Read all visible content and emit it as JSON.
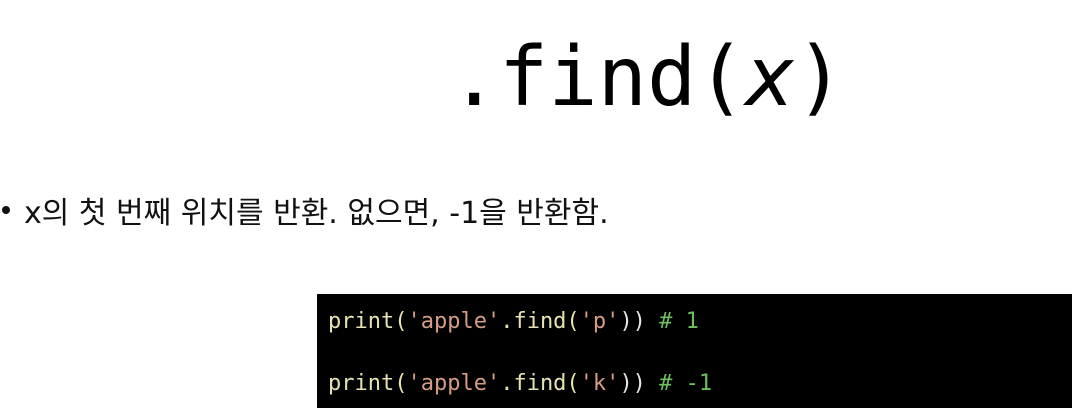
{
  "slide": {
    "title_prefix": ".find(",
    "title_arg": "x",
    "title_suffix": ")",
    "bullet_text": "x의 첫 번째 위치를 반환. 없으면, -1을 반환함."
  },
  "code": {
    "lines": [
      {
        "fn": "print(",
        "str1": "'apple'",
        "method": ".find(",
        "str2": "'p'",
        "close": "))",
        "comment": " # 1"
      },
      {
        "fn": "print(",
        "str1": "'apple'",
        "method": ".find(",
        "str2": "'k'",
        "close": "))",
        "comment": " # -1"
      }
    ]
  },
  "colors": {
    "background": "#ffffff",
    "code_background": "#000000",
    "code_function": "#e8e2b2",
    "code_string": "#d69d85",
    "code_comment": "#6fbf5f"
  }
}
